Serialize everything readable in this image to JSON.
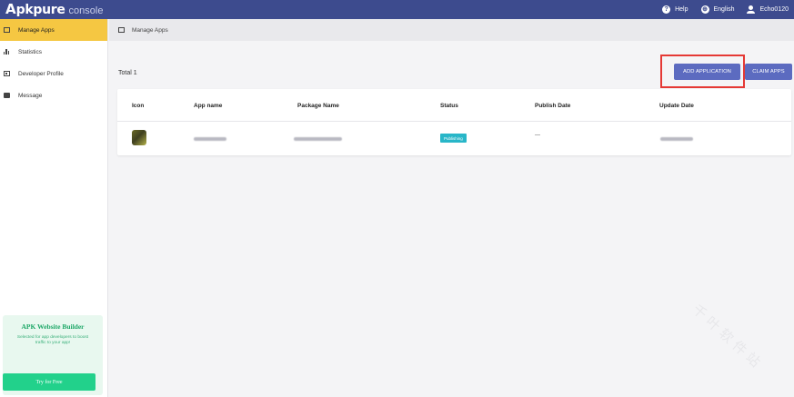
{
  "header": {
    "logo_mark": "A",
    "logo_text": "pkpure",
    "logo_sub": "console",
    "nav": [
      {
        "icon": "help-icon",
        "label": "Help"
      },
      {
        "icon": "globe-icon",
        "label": "English"
      },
      {
        "icon": "user-icon",
        "label": "Echo0120"
      }
    ]
  },
  "sidebar": {
    "items": [
      {
        "icon": "box-icon",
        "label": "Manage Apps",
        "active": true
      },
      {
        "icon": "bar-chart-icon",
        "label": "Statistics",
        "active": false
      },
      {
        "icon": "id-card-icon",
        "label": "Developer Profile",
        "active": false
      },
      {
        "icon": "message-icon",
        "label": "Message",
        "active": false
      }
    ],
    "promo": {
      "title": "APK Website Builder",
      "description": "Selected for app developers to boost traffic to your app!",
      "button": "Try for Free"
    }
  },
  "breadcrumb": "Manage Apps",
  "toolbar": {
    "total": "Total 1",
    "add_button": "ADD APPLICATION",
    "claim_button": "CLAIM APPS"
  },
  "table": {
    "columns": [
      "Icon",
      "App name",
      "Package Name",
      "Status",
      "Publish Date",
      "Update Date"
    ],
    "rows": [
      {
        "status": "Publishing",
        "publish_date": "—"
      }
    ]
  },
  "colors": {
    "topbar": "#3d4b8e",
    "sidebar_active": "#f5c742",
    "primary_button": "#5c6bc0",
    "status_badge": "#28b6c8",
    "highlight_box": "#e53935",
    "promo_button": "#22d18b"
  }
}
